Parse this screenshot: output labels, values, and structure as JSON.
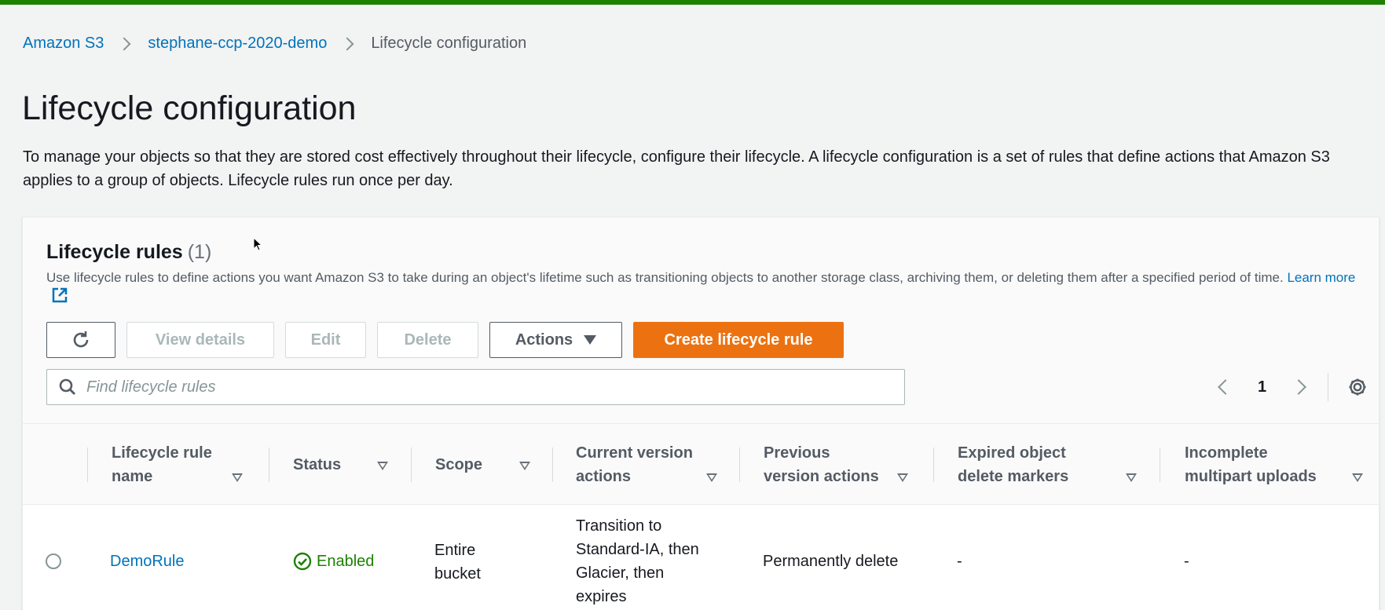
{
  "breadcrumb": {
    "items": [
      "Amazon S3",
      "stephane-ccp-2020-demo"
    ],
    "current": "Lifecycle configuration"
  },
  "page": {
    "title": "Lifecycle configuration",
    "description": "To manage your objects so that they are stored cost effectively throughout their lifecycle, configure their lifecycle. A lifecycle configuration is a set of rules that define actions that Amazon S3 applies to a group of objects. Lifecycle rules run once per day."
  },
  "panel": {
    "title": "Lifecycle rules",
    "count": "(1)",
    "description": "Use lifecycle rules to define actions you want Amazon S3 to take during an object's lifetime such as transitioning objects to another storage class, archiving them, or deleting them after a specified period of time.",
    "learn_more": "Learn more"
  },
  "toolbar": {
    "view_details": "View details",
    "edit": "Edit",
    "delete": "Delete",
    "actions": "Actions",
    "create": "Create lifecycle rule"
  },
  "search": {
    "placeholder": "Find lifecycle rules"
  },
  "pagination": {
    "page": "1"
  },
  "table": {
    "columns": [
      [
        "Lifecycle rule",
        "name"
      ],
      [
        "Status"
      ],
      [
        "Scope"
      ],
      [
        "Current version",
        "actions"
      ],
      [
        "Previous",
        "version actions"
      ],
      [
        "Expired object",
        "delete markers"
      ],
      [
        "Incomplete",
        "multipart uploads"
      ]
    ],
    "rows": [
      {
        "name": "DemoRule",
        "status": "Enabled",
        "scope": [
          "Entire",
          "bucket"
        ],
        "current_version_actions": [
          "Transition to",
          "Standard-IA, then",
          "Glacier, then",
          "expires"
        ],
        "previous_version_actions": "Permanently delete",
        "expired_object_delete_markers": "-",
        "incomplete_multipart_uploads": "-"
      }
    ]
  },
  "colors": {
    "accent_orange": "#ec7211",
    "link_blue": "#0073bb",
    "success_green": "#1d8102"
  }
}
